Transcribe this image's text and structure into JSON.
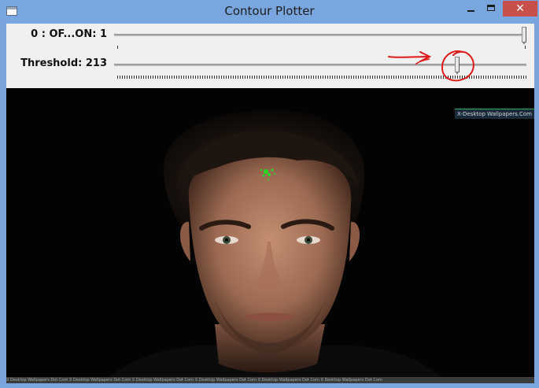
{
  "window": {
    "title": "Contour Plotter",
    "close_symbol": "✕",
    "min_symbol": "—"
  },
  "controls": {
    "trackbars": [
      {
        "label": "0 : OF...ON: 1",
        "value": 1,
        "max": 1
      },
      {
        "label": "Threshold: 213",
        "value": 213,
        "max": 255
      }
    ]
  },
  "image": {
    "description_icon": "portrait-photo",
    "watermark": "X-Desktop Wallpapers.Com",
    "footer_text": "X Desktop Wallpapers Dot Com    X Desktop Wallpapers Dot Com    X Desktop Wallpapers Dot Com    X Desktop Wallpapers Dot Com    X Desktop Wallpapers Dot Com    X Desktop Wallpapers Dot Com",
    "contour_color": "#22dd22"
  },
  "annotation": {
    "color": "#e01818",
    "icon": "red-arrow-and-circle-annotation"
  },
  "colors": {
    "titlebar": "#7aa6df",
    "close": "#c7504b",
    "panel": "#f0f0f0"
  }
}
